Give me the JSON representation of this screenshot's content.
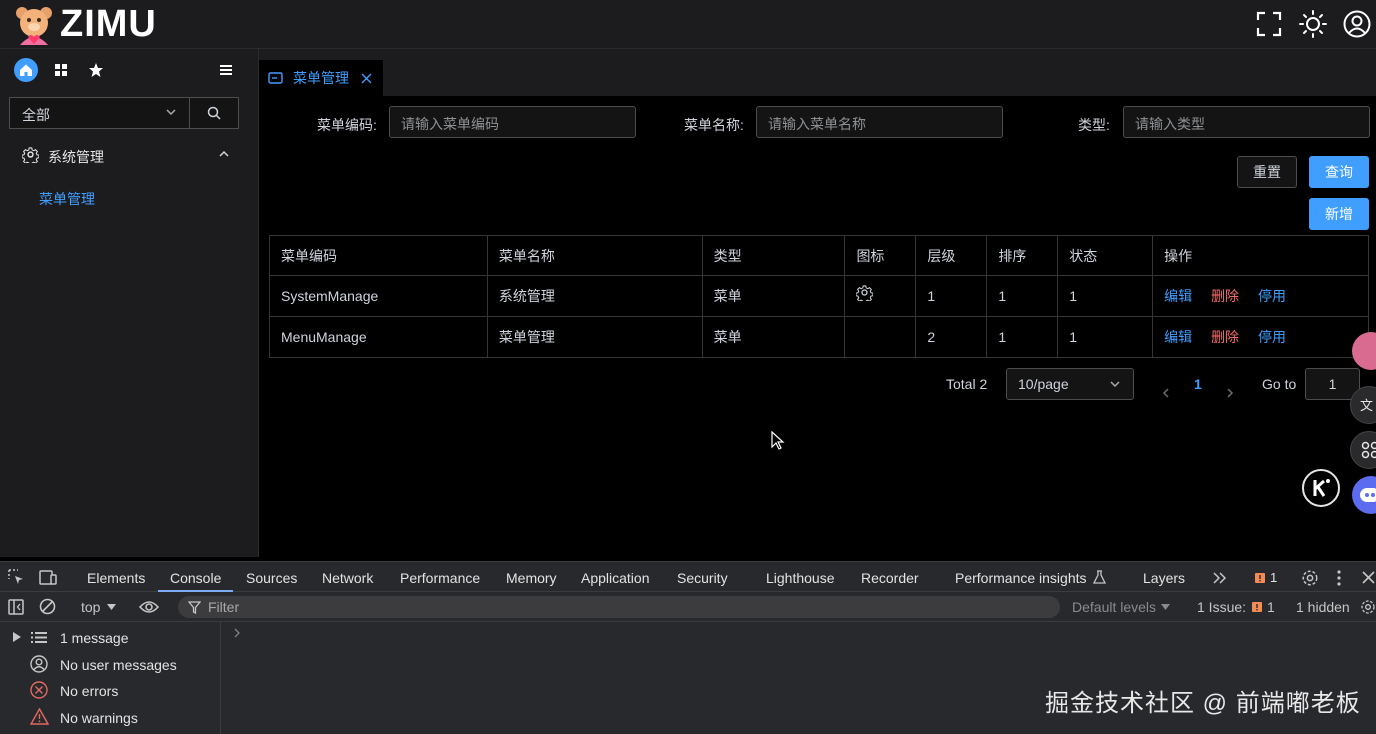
{
  "app": {
    "brand": "ZIMU"
  },
  "colors": {
    "accent": "#409eff",
    "danger": "#f56c6c"
  },
  "header": {
    "icons": [
      "fullscreen-icon",
      "theme-sun-icon",
      "user-icon"
    ]
  },
  "sidebar": {
    "scope_select": "全部",
    "group_label": "系统管理",
    "item_label": "菜单管理"
  },
  "tabs": [
    {
      "label": "菜单管理"
    }
  ],
  "search": {
    "code_label": "菜单编码:",
    "code_placeholder": "请输入菜单编码",
    "name_label": "菜单名称:",
    "name_placeholder": "请输入菜单名称",
    "type_label": "类型:",
    "type_placeholder": "请输入类型",
    "reset": "重置",
    "query": "查询",
    "add": "新增"
  },
  "table": {
    "headers": [
      "菜单编码",
      "菜单名称",
      "类型",
      "图标",
      "层级",
      "排序",
      "状态",
      "操作"
    ],
    "rows": [
      {
        "code": "SystemManage",
        "name": "系统管理",
        "type": "菜单",
        "icon": "setting-icon",
        "level": "1",
        "sort": "1",
        "status": "1"
      },
      {
        "code": "MenuManage",
        "name": "菜单管理",
        "type": "菜单",
        "icon": "",
        "level": "2",
        "sort": "1",
        "status": "1"
      }
    ],
    "actions": {
      "edit": "编辑",
      "delete": "删除",
      "disable": "停用"
    }
  },
  "pagination": {
    "total": "Total 2",
    "page_size": "10/page",
    "current": "1",
    "goto_label": "Go to",
    "goto_value": "1"
  },
  "devtools": {
    "tabs": [
      "Elements",
      "Console",
      "Sources",
      "Network",
      "Performance",
      "Memory",
      "Application",
      "Security",
      "Lighthouse",
      "Recorder",
      "Performance insights",
      "Layers"
    ],
    "active_tab": "Console",
    "issue_badge": "1",
    "context": "top",
    "filter_placeholder": "Filter",
    "levels": "Default levels",
    "issues_label": "1 Issue:",
    "issues_count": "1",
    "hidden": "1 hidden",
    "sidebar": [
      "1 message",
      "No user messages",
      "No errors",
      "No warnings"
    ]
  },
  "watermark": "掘金技术社区 @ 前端嘟老板"
}
